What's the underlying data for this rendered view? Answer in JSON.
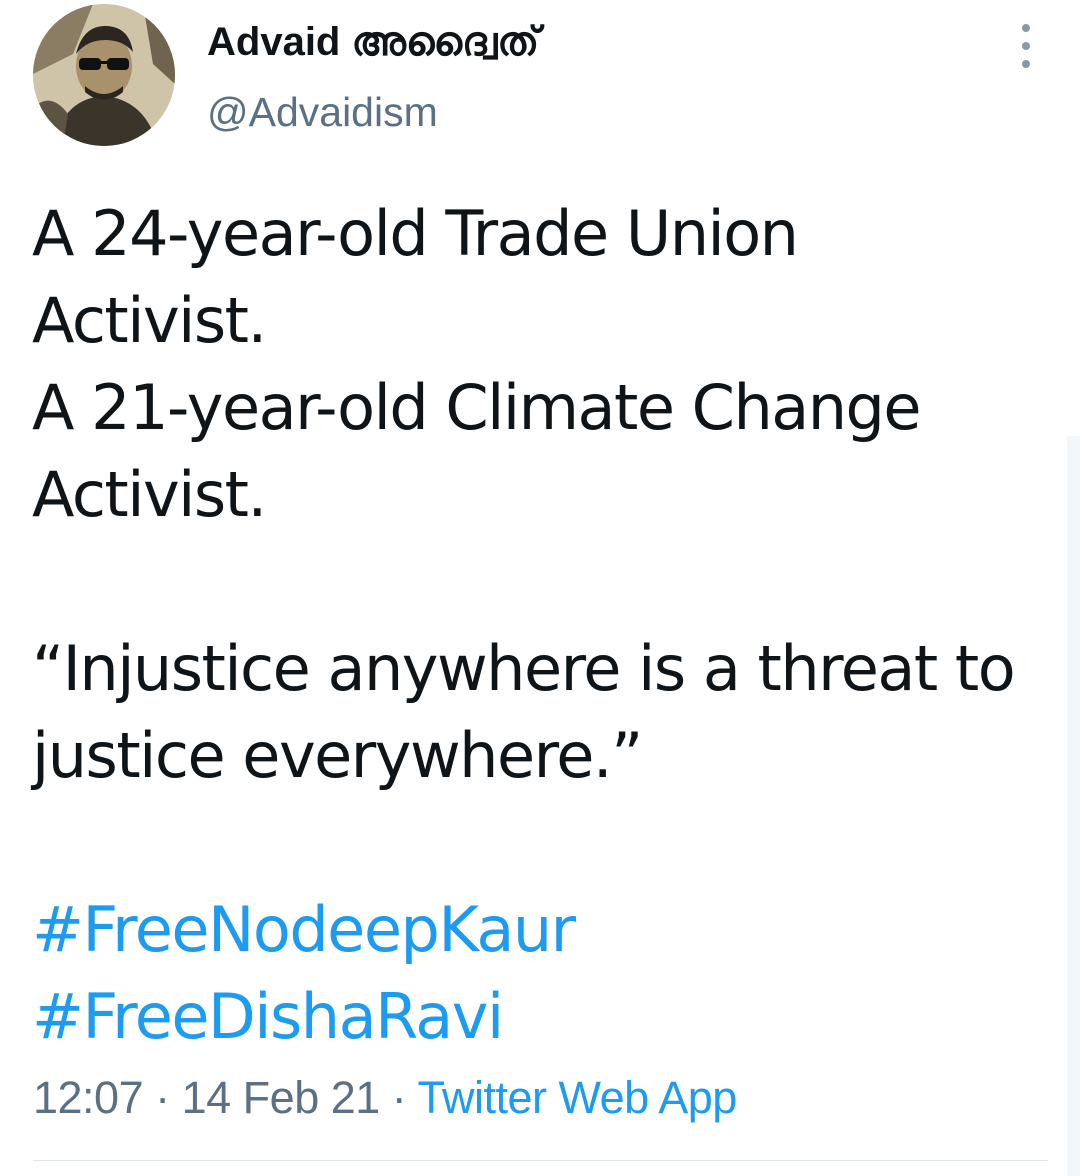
{
  "author": {
    "display_name": "Advaid അദ്വൈത്",
    "handle": "@Advaidism"
  },
  "tweet": {
    "lines": [
      "A 24-year-old Trade Union",
      "Activist.",
      "A 21-year-old Climate Change",
      "Activist.",
      "",
      "“Injustice anywhere is a threat to",
      "justice everywhere.”",
      ""
    ],
    "hashtags": [
      "#FreeNodeepKaur",
      "#FreeDishaRavi"
    ]
  },
  "meta": {
    "time": "12:07",
    "separator": " · ",
    "date": "14 Feb 21",
    "source": "Twitter Web App"
  },
  "colors": {
    "text": "#0f1419",
    "secondary": "#5b7083",
    "link": "#1d9bf0"
  },
  "icons": {
    "more": "more-vertical-icon"
  }
}
